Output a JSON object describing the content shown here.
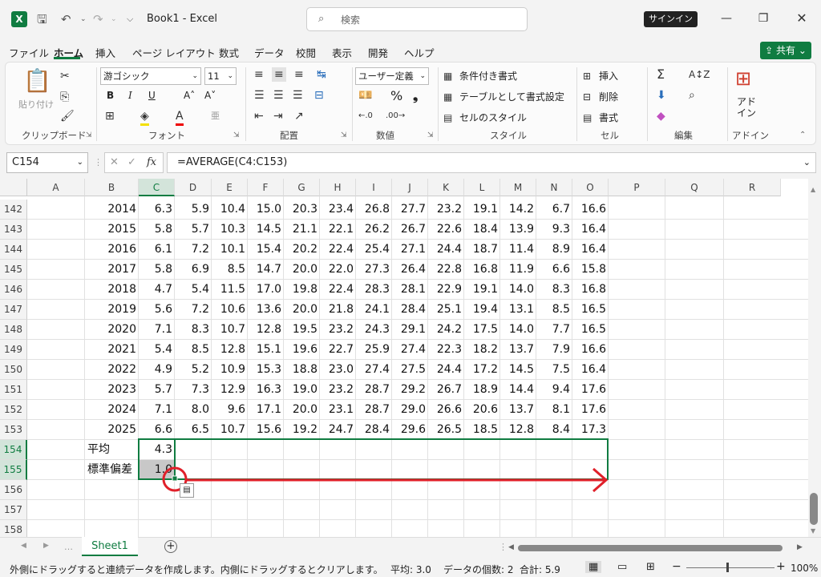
{
  "app": {
    "book_title": "Book1  -  Excel",
    "search_placeholder": "検索",
    "signin": "サインイン"
  },
  "menu": {
    "items": [
      "ファイル",
      "ホーム",
      "挿入",
      "ページ レイアウト",
      "数式",
      "データ",
      "校閲",
      "表示",
      "開発",
      "ヘルプ"
    ],
    "share": "共有"
  },
  "ribbon": {
    "clipboard": {
      "paste": "貼り付け",
      "label": "クリップボード"
    },
    "font": {
      "name": "游ゴシック",
      "size": "11",
      "label": "フォント",
      "bold": "B",
      "italic": "I",
      "underline": "U",
      "grow": "A˄",
      "shrink": "A˅"
    },
    "alignment": {
      "label": "配置"
    },
    "number": {
      "format": "ユーザー定義",
      "label": "数値",
      "percent": "%",
      "comma": "❟"
    },
    "styles": {
      "conditional": "条件付き書式",
      "table": "テーブルとして書式設定",
      "cell_styles": "セルのスタイル",
      "label": "スタイル"
    },
    "cells": {
      "insert": "挿入",
      "delete": "削除",
      "format": "書式",
      "label": "セル"
    },
    "editing": {
      "label": "編集"
    },
    "addins": {
      "button": "アド\nイン",
      "label": "アドイン"
    }
  },
  "formula_bar": {
    "name_box": "C154",
    "fx": "fx",
    "formula": "=AVERAGE(C4:C153)"
  },
  "columns": [
    "A",
    "B",
    "C",
    "D",
    "E",
    "F",
    "G",
    "H",
    "I",
    "J",
    "K",
    "L",
    "M",
    "N",
    "O",
    "P",
    "Q",
    "R"
  ],
  "rows": [
    {
      "num": "142",
      "b": "2014",
      "vals": [
        "6.3",
        "5.9",
        "10.4",
        "15.0",
        "20.3",
        "23.4",
        "26.8",
        "27.7",
        "23.2",
        "19.1",
        "14.2",
        "6.7",
        "16.6"
      ]
    },
    {
      "num": "143",
      "b": "2015",
      "vals": [
        "5.8",
        "5.7",
        "10.3",
        "14.5",
        "21.1",
        "22.1",
        "26.2",
        "26.7",
        "22.6",
        "18.4",
        "13.9",
        "9.3",
        "16.4"
      ]
    },
    {
      "num": "144",
      "b": "2016",
      "vals": [
        "6.1",
        "7.2",
        "10.1",
        "15.4",
        "20.2",
        "22.4",
        "25.4",
        "27.1",
        "24.4",
        "18.7",
        "11.4",
        "8.9",
        "16.4"
      ]
    },
    {
      "num": "145",
      "b": "2017",
      "vals": [
        "5.8",
        "6.9",
        "8.5",
        "14.7",
        "20.0",
        "22.0",
        "27.3",
        "26.4",
        "22.8",
        "16.8",
        "11.9",
        "6.6",
        "15.8"
      ]
    },
    {
      "num": "146",
      "b": "2018",
      "vals": [
        "4.7",
        "5.4",
        "11.5",
        "17.0",
        "19.8",
        "22.4",
        "28.3",
        "28.1",
        "22.9",
        "19.1",
        "14.0",
        "8.3",
        "16.8"
      ]
    },
    {
      "num": "147",
      "b": "2019",
      "vals": [
        "5.6",
        "7.2",
        "10.6",
        "13.6",
        "20.0",
        "21.8",
        "24.1",
        "28.4",
        "25.1",
        "19.4",
        "13.1",
        "8.5",
        "16.5"
      ]
    },
    {
      "num": "148",
      "b": "2020",
      "vals": [
        "7.1",
        "8.3",
        "10.7",
        "12.8",
        "19.5",
        "23.2",
        "24.3",
        "29.1",
        "24.2",
        "17.5",
        "14.0",
        "7.7",
        "16.5"
      ]
    },
    {
      "num": "149",
      "b": "2021",
      "vals": [
        "5.4",
        "8.5",
        "12.8",
        "15.1",
        "19.6",
        "22.7",
        "25.9",
        "27.4",
        "22.3",
        "18.2",
        "13.7",
        "7.9",
        "16.6"
      ]
    },
    {
      "num": "150",
      "b": "2022",
      "vals": [
        "4.9",
        "5.2",
        "10.9",
        "15.3",
        "18.8",
        "23.0",
        "27.4",
        "27.5",
        "24.4",
        "17.2",
        "14.5",
        "7.5",
        "16.4"
      ]
    },
    {
      "num": "151",
      "b": "2023",
      "vals": [
        "5.7",
        "7.3",
        "12.9",
        "16.3",
        "19.0",
        "23.2",
        "28.7",
        "29.2",
        "26.7",
        "18.9",
        "14.4",
        "9.4",
        "17.6"
      ]
    },
    {
      "num": "152",
      "b": "2024",
      "vals": [
        "7.1",
        "8.0",
        "9.6",
        "17.1",
        "20.0",
        "23.1",
        "28.7",
        "29.0",
        "26.6",
        "20.6",
        "13.7",
        "8.1",
        "17.6"
      ]
    },
    {
      "num": "153",
      "b": "2025",
      "vals": [
        "6.6",
        "6.5",
        "10.7",
        "15.6",
        "19.2",
        "24.7",
        "28.4",
        "29.6",
        "26.5",
        "18.5",
        "12.8",
        "8.4",
        "17.3"
      ]
    },
    {
      "num": "154",
      "b": "平均",
      "vals": [
        "4.3"
      ]
    },
    {
      "num": "155",
      "b": "標準偏差",
      "vals": [
        "1.0"
      ]
    },
    {
      "num": "156",
      "b": "",
      "vals": []
    },
    {
      "num": "157",
      "b": "",
      "vals": []
    },
    {
      "num": "158",
      "b": "",
      "vals": []
    }
  ],
  "sheets": {
    "active": "Sheet1"
  },
  "status": {
    "message": "外側にドラッグすると連続データを作成します。内側にドラッグするとクリアします。",
    "average": "平均: 3.0",
    "count": "データの個数: 2",
    "sum": "合計: 5.9",
    "zoom": "100%"
  },
  "colors": {
    "accent": "#107c41",
    "annotation": "#e0202a"
  }
}
